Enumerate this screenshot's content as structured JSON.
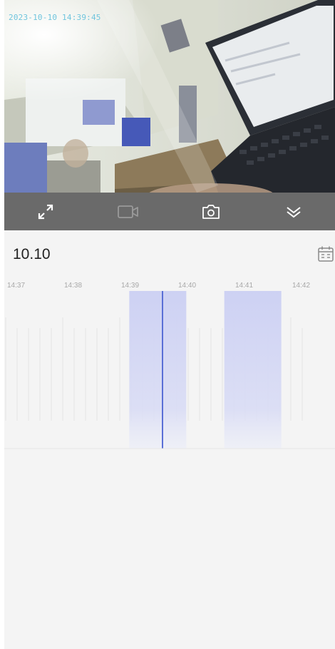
{
  "video": {
    "timestamp": "2023-10-10 14:39:45"
  },
  "controls": {
    "icons": [
      "fullscreen-icon",
      "record-video-icon",
      "snapshot-camera-icon",
      "collapse-double-chevron-icon"
    ],
    "bar_color": "#6a6a6a"
  },
  "date": {
    "label": "10.10",
    "calendar_icon": "calendar-icon"
  },
  "timeline": {
    "tick_labels": [
      "14:37",
      "14:38",
      "14:39",
      "14:40",
      "14:41",
      "14:42"
    ],
    "recorded_segments": [
      {
        "start": "14:39:10",
        "end": "14:40:10"
      },
      {
        "start": "14:40:50",
        "end": "14:41:50"
      }
    ],
    "current_time": "14:39:45",
    "segment_color": "#cdd1f3",
    "cursor_color": "#5a6fd6"
  }
}
